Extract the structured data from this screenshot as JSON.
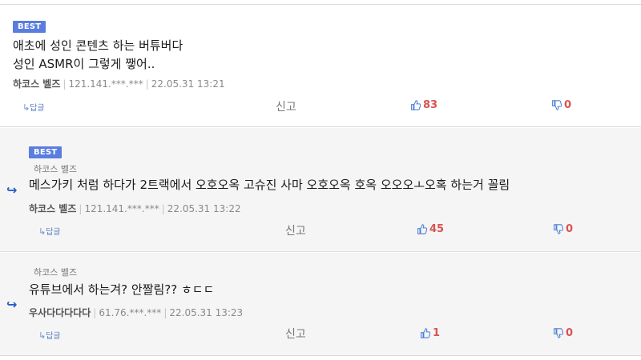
{
  "comments": [
    {
      "badge": "BEST",
      "text_lines": [
        "애초에 성인 콘텐츠 하는 버튜버다",
        "성인 ASMR이 그렇게 쨓어.."
      ],
      "nick": "하코스 벨즈",
      "ip": "121.141.***.***",
      "date": "22.05.31 13:21",
      "reply_label": "답글",
      "report_label": "신고",
      "likes": "83",
      "dislikes": "0"
    },
    {
      "badge": "BEST",
      "quote": "하코스 벨즈",
      "text_lines": [
        "메스가키 처럼 하다가 2트랙에서 오호오옥 고슈진 사마 오호오옥 호옥 오오오ㅗ오혹 하는거 꼴림"
      ],
      "nick": "하코스 벨즈",
      "ip": "121.141.***.***",
      "date": "22.05.31 13:22",
      "reply_label": "답글",
      "report_label": "신고",
      "likes": "45",
      "dislikes": "0"
    },
    {
      "quote": "하코스 벨즈",
      "text_lines": [
        "유튜브에서 하는겨? 안짤림?? ㅎㄷㄷ"
      ],
      "nick": "우사다다다다다",
      "ip": "61.76.***.***",
      "date": "22.05.31 13:23",
      "reply_label": "답글",
      "report_label": "신고",
      "likes": "1",
      "dislikes": "0"
    }
  ],
  "icons": {
    "reply_arrow": "reply-arrow-icon",
    "thumb_up": "thumbs-up-icon",
    "thumb_down": "thumbs-down-icon",
    "nested": "nested-reply-arrow-icon"
  },
  "colors": {
    "badge": "#5a7de0",
    "count": "#d9534f",
    "thumb": "#4a7fd6"
  }
}
